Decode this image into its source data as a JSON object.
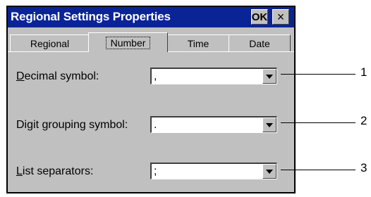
{
  "window": {
    "title": "Regional Settings Properties",
    "ok_label": "OK",
    "close_label": "×"
  },
  "tabs": [
    {
      "label": "Regional"
    },
    {
      "label": "Number"
    },
    {
      "label": "Time"
    },
    {
      "label": "Date"
    }
  ],
  "selected_tab": "Number",
  "fields": {
    "decimal": {
      "label_first": "D",
      "label_rest": "ecimal symbol:",
      "value": ","
    },
    "digit_grouping": {
      "label_pre": "Digit ",
      "label_u": "g",
      "label_post": "rouping symbol:",
      "value": "."
    },
    "list_separators": {
      "label_first": "L",
      "label_rest": "ist separators:",
      "value": ";"
    }
  },
  "callouts": [
    "1",
    "2",
    "3"
  ],
  "colors": {
    "titlebar": "#0a2496",
    "dialog": "#c0c0c0"
  }
}
